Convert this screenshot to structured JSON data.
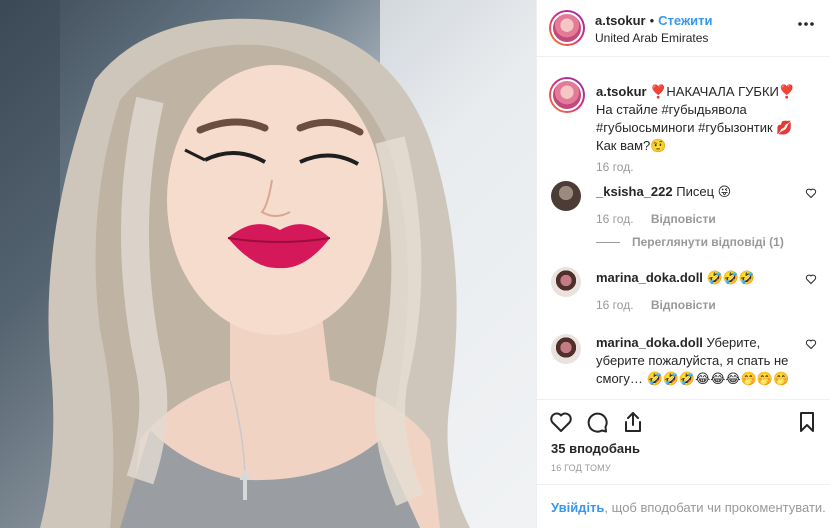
{
  "post": {
    "username": "a.tsokur",
    "separator": "•",
    "follow_label": "Стежити",
    "location": "United Arab Emirates"
  },
  "caption": {
    "username": "a.tsokur",
    "text": "❣️НАКАЧАЛА ГУБКИ❣️ На стайле #губыдьявола #губыосьминоги #губызонтик 💋 Как вам?🤨",
    "time": "16 год."
  },
  "comments": [
    {
      "username": "_ksisha_222",
      "text": "Писец 😜",
      "time": "16 год.",
      "reply_label": "Відповісти",
      "view_replies": "Переглянути відповіді (1)"
    },
    {
      "username": "marina_doka.doll",
      "text": "🤣🤣🤣",
      "time": "16 год.",
      "reply_label": "Відповісти"
    },
    {
      "username": "marina_doka.doll",
      "text": "Уберите, уберите пожалуйста, я спать не смогу… 🤣🤣🤣😂😂😂🤭🤭🤭"
    }
  ],
  "footer": {
    "likes": "35 вподобань",
    "time_ago": "16 ГОД ТОМУ",
    "login_link": "Увійдіть",
    "login_text": ", щоб вподобати чи прокоментувати."
  },
  "colors": {
    "link": "#3897f0",
    "muted": "#999999",
    "text": "#262626"
  },
  "icons": [
    "more-icon",
    "heart-icon",
    "comment-icon",
    "share-icon",
    "bookmark-icon"
  ]
}
